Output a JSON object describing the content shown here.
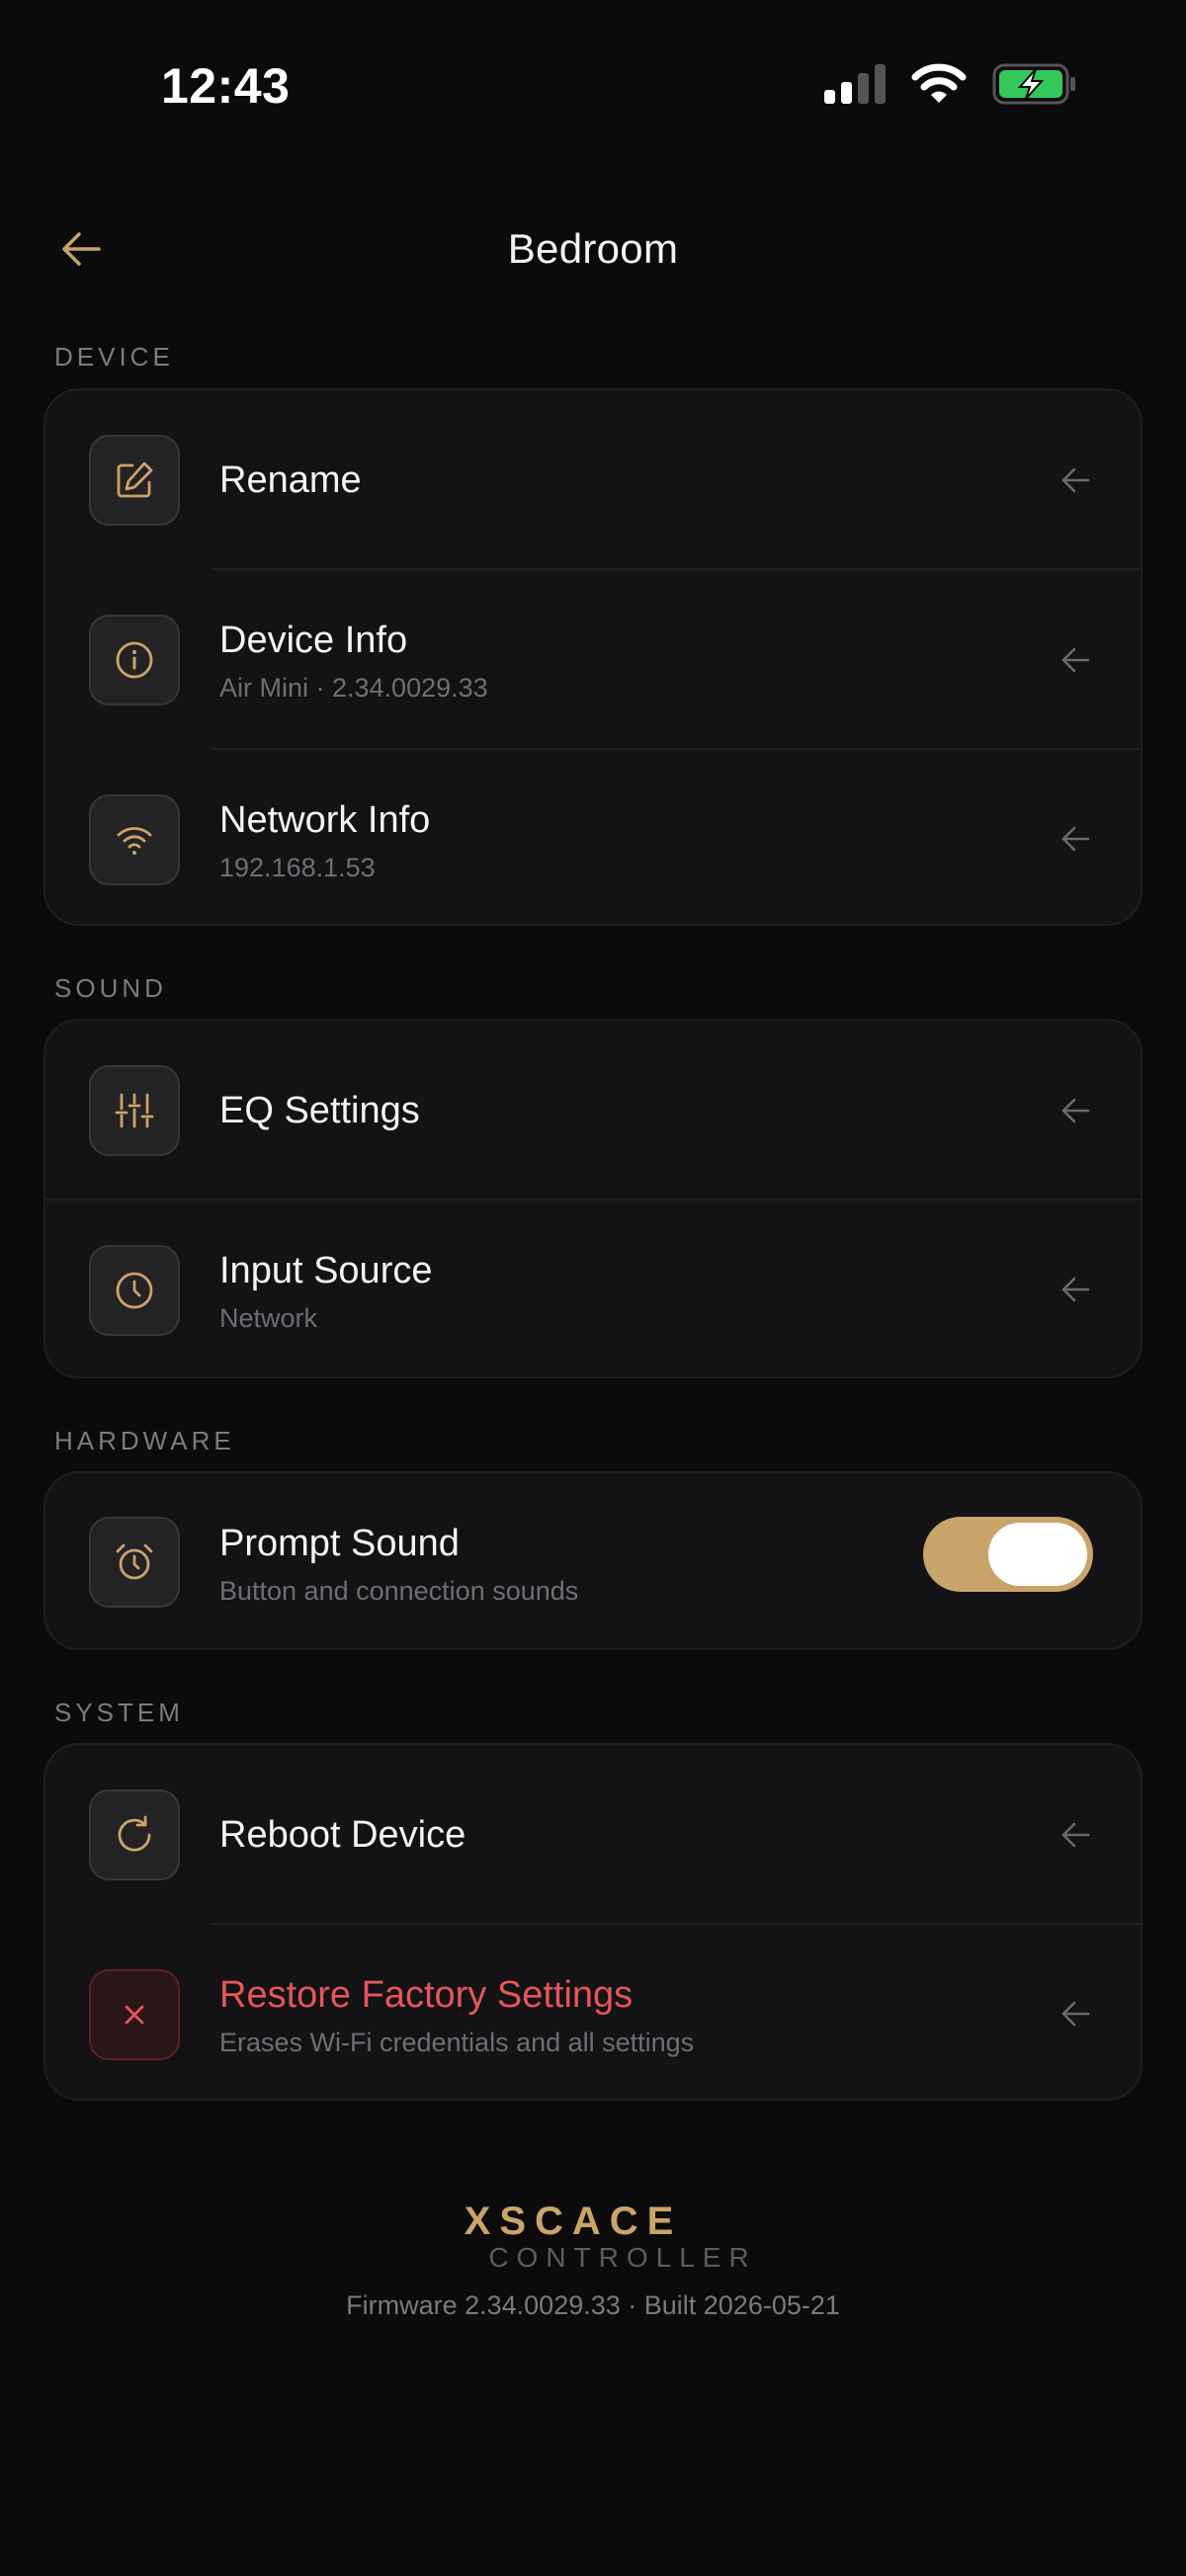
{
  "status_bar": {
    "time": "12:43",
    "battery_color": "#33c759"
  },
  "header": {
    "title": "Bedroom",
    "back_icon": "arrow-left-icon"
  },
  "accent_color": "#c9a46a",
  "danger_color": "#e5555a",
  "sections": {
    "device": {
      "label": "DEVICE",
      "items": [
        {
          "title": "Rename",
          "icon": "edit-icon"
        },
        {
          "title": "Device Info",
          "subtitle": "Air Mini · 2.34.0029.33",
          "icon": "info-icon"
        },
        {
          "title": "Network Info",
          "subtitle": "192.168.1.53",
          "icon": "wifi-icon"
        }
      ]
    },
    "sound": {
      "label": "SOUND",
      "items": [
        {
          "title": "EQ Settings",
          "icon": "sliders-icon"
        },
        {
          "title": "Input Source",
          "subtitle": "Network",
          "icon": "clock-icon"
        }
      ]
    },
    "hardware": {
      "label": "HARDWARE",
      "items": [
        {
          "title": "Prompt Sound",
          "subtitle": "Button and connection sounds",
          "icon": "alarm-clock-icon",
          "toggle_on": true
        }
      ]
    },
    "system": {
      "label": "SYSTEM",
      "items": [
        {
          "title": "Reboot Device",
          "icon": "refresh-icon"
        },
        {
          "title": "Restore Factory Settings",
          "subtitle": "Erases Wi-Fi credentials and all settings",
          "icon": "close-icon"
        }
      ]
    }
  },
  "footer": {
    "brand": "XSCACE",
    "brand_sub": "CONTROLLER",
    "firmware": "Firmware 2.34.0029.33 · Built 2026-05-21"
  }
}
